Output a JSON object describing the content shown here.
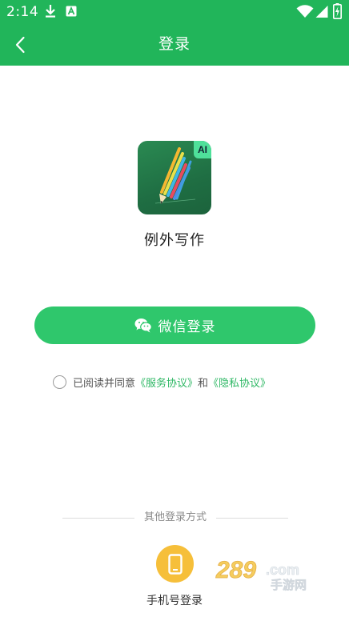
{
  "status_bar": {
    "time": "2:14",
    "icons": [
      "download-icon",
      "font-a-icon",
      "wifi-icon",
      "signal-icon",
      "battery-icon"
    ]
  },
  "app_bar": {
    "title": "登录",
    "back_icon": "back-arrow-icon"
  },
  "app": {
    "name": "例外写作",
    "logo_badge": "AI",
    "logo_icon": "pencil-logo-icon"
  },
  "wechat_login": {
    "label": "微信登录",
    "icon": "wechat-icon"
  },
  "agreement": {
    "prefix": "已阅读并同意",
    "service_link": "《服务协议》",
    "connector": "和",
    "privacy_link": "《隐私协议》",
    "checked": false
  },
  "other_login": {
    "title": "其他登录方式",
    "phone_label": "手机号登录",
    "phone_icon": "phone-icon"
  },
  "watermark": {
    "text": "289.com",
    "subtext": "手游网"
  },
  "colors": {
    "primary": "#21b55a",
    "button": "#2fc76c",
    "link": "#2fb865",
    "phone_button": "#f6bf3a"
  }
}
